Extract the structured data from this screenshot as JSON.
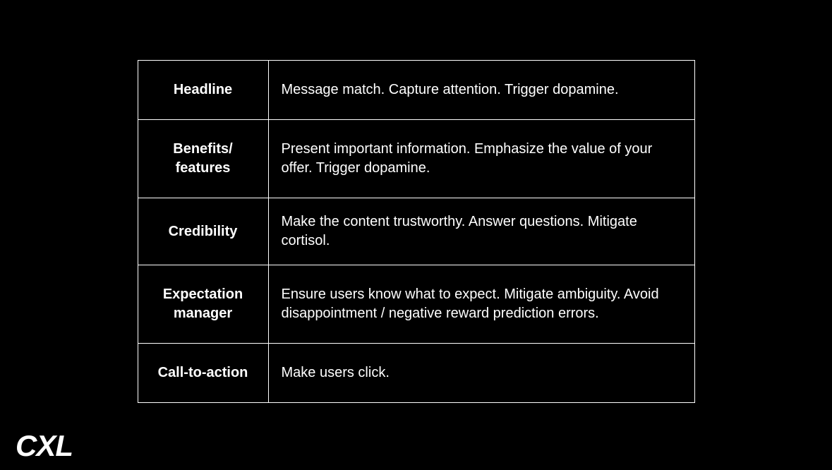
{
  "rows": [
    {
      "label": "Headline",
      "desc": "Message match. Capture attention. Trigger dopamine."
    },
    {
      "label": "Benefits/\nfeatures",
      "desc": "Present important information. Emphasize the value of your offer. Trigger dopamine."
    },
    {
      "label": "Credibility",
      "desc": "Make the content trustworthy. Answer questions. Mitigate cortisol."
    },
    {
      "label": "Expectation\nmanager",
      "desc": "Ensure users know what to expect. Mitigate ambiguity. Avoid disappointment / negative reward prediction errors."
    },
    {
      "label": "Call-to-action",
      "desc": "Make users click."
    }
  ],
  "logo": "CXL"
}
